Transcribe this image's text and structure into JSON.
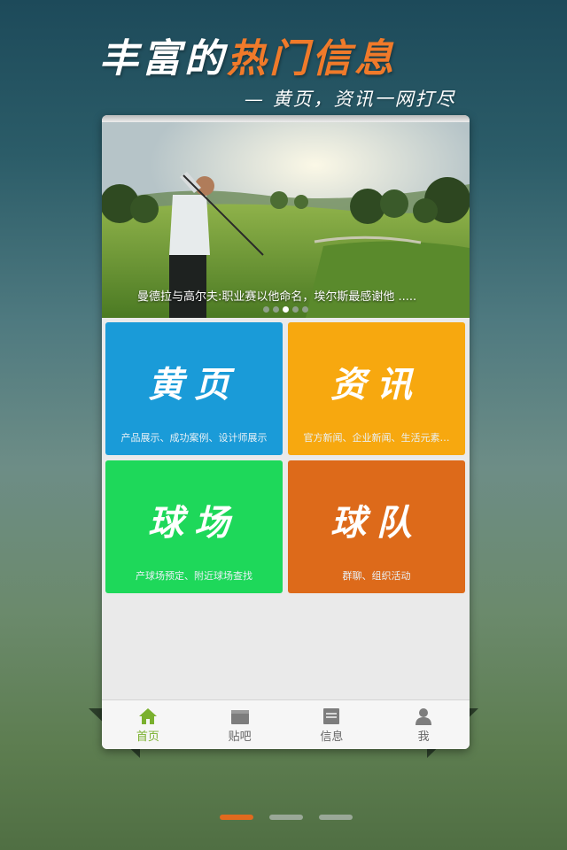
{
  "header": {
    "title_plain": "丰富的",
    "title_highlight": "热门信息",
    "subtitle": "— 黄页，资讯一网打尽"
  },
  "banner": {
    "caption": "曼德拉与高尔夫:职业赛以他命名，埃尔斯最感谢他 .....",
    "slide_count": 5,
    "active_slide": 3
  },
  "tiles": [
    {
      "title": "黄页",
      "desc": "产品展示、成功案例、设计师展示",
      "color": "#1a9bd8"
    },
    {
      "title": "资讯",
      "desc": "官方新闻、企业新闻、生活元素…",
      "color": "#f7a80f"
    },
    {
      "title": "球场",
      "desc": "产球场预定、附近球场查找",
      "color": "#1ed85a"
    },
    {
      "title": "球队",
      "desc": "群聊、组织活动",
      "color": "#dd6a1a"
    }
  ],
  "tab_bar": {
    "items": [
      {
        "label": "首页",
        "icon": "home-icon",
        "active": true
      },
      {
        "label": "贴吧",
        "icon": "folder-icon",
        "active": false
      },
      {
        "label": "信息",
        "icon": "document-icon",
        "active": false
      },
      {
        "label": "我",
        "icon": "person-icon",
        "active": false
      }
    ]
  },
  "pager": {
    "pages": 3,
    "active": 1
  },
  "colors": {
    "accent_orange": "#f07a2a",
    "active_tab": "#7ab02e"
  }
}
